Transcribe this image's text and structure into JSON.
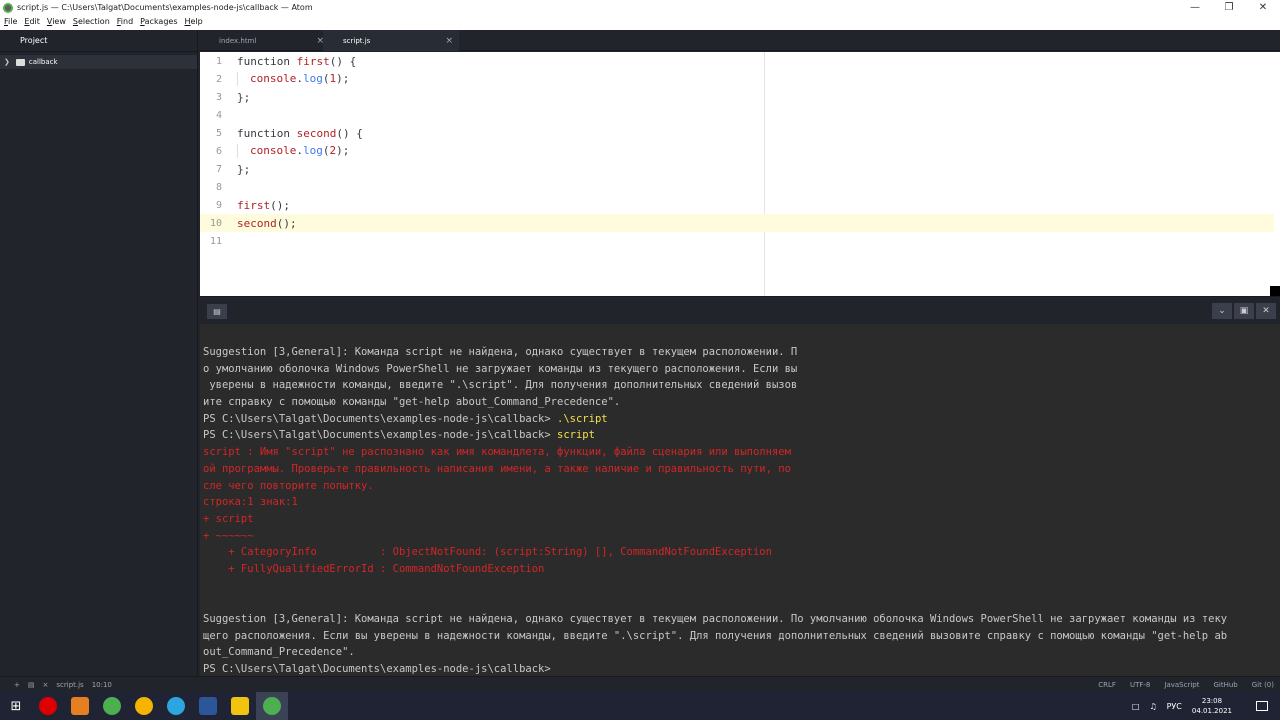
{
  "window": {
    "title": "script.js — C:\\Users\\Talgat\\Documents\\examples-node-js\\callback — Atom"
  },
  "menu": [
    "File",
    "Edit",
    "View",
    "Selection",
    "Find",
    "Packages",
    "Help"
  ],
  "sidebar": {
    "header": "Project",
    "items": [
      {
        "label": "callback"
      }
    ]
  },
  "tabs": [
    {
      "label": "index.html"
    },
    {
      "label": "script.js"
    }
  ],
  "editor": {
    "lines": [
      "1",
      "2",
      "3",
      "4",
      "5",
      "6",
      "7",
      "8",
      "9",
      "10",
      "11"
    ],
    "code": {
      "l1_kw": "function ",
      "l1_fn": "first",
      "l1_rest": "() {",
      "l2_obj": "console",
      "l2_dot": ".",
      "l2_m": "log",
      "l2_p1": "(",
      "l2_n": "1",
      "l2_p2": ");",
      "l3": "};",
      "l5_kw": "function ",
      "l5_fn": "second",
      "l5_rest": "() {",
      "l6_obj": "console",
      "l6_dot": ".",
      "l6_m": "log",
      "l6_p1": "(",
      "l6_n": "2",
      "l6_p2": ");",
      "l7": "};",
      "l9_fn": "first",
      "l9_rest": "();",
      "l10_fn": "second",
      "l10_rest": "();"
    }
  },
  "terminal": {
    "t1": "Suggestion [3,General]: Команда script не найдена, однако существует в текущем расположении. П",
    "t2": "о умолчанию оболочка Windows PowerShell не загружает команды из текущего расположения. Если вы",
    "t3": " уверены в надежности команды, введите \".\\script\". Для получения дополнительных сведений вызов",
    "t4": "ите справку с помощью команды \"get-help about_Command_Precedence\".",
    "t5_prompt": "PS C:\\Users\\Talgat\\Documents\\examples-node-js\\callback> ",
    "t5_cmd": ".\\script",
    "t6_prompt": "PS C:\\Users\\Talgat\\Documents\\examples-node-js\\callback> ",
    "t6_cmd": "script",
    "e1": "script : Имя \"script\" не распознано как имя командлета, функции, файла сценария или выполняем",
    "e2": "ой программы. Проверьте правильность написания имени, а также наличие и правильность пути, по",
    "e3": "сле чего повторите попытку.",
    "e4": "строка:1 знак:1",
    "e5": "+ script",
    "e6": "+ ~~~~~~",
    "e7": "    + CategoryInfo          : ObjectNotFound: (script:String) [], CommandNotFoundException",
    "e8": "    + FullyQualifiedErrorId : CommandNotFoundException",
    "s1": "Suggestion [3,General]: Команда script не найдена, однако существует в текущем расположении. По умолчанию оболочка Windows PowerShell не загружает команды из теку",
    "s2": "щего расположения. Если вы уверены в надежности команды, введите \".\\script\". Для получения дополнительных сведений вызовите справку с помощью команды \"get-help ab",
    "s3": "out_Command_Precedence\".",
    "p": "PS C:\\Users\\Talgat\\Documents\\examples-node-js\\callback>"
  },
  "status": {
    "file": "script.js",
    "pos": "10:10",
    "crlf": "CRLF",
    "enc": "UTF-8",
    "lang": "JavaScript",
    "github": "GitHub",
    "git": "Git (0)"
  },
  "taskbar": {
    "lang": "РУС",
    "time": "23:08",
    "date": "04.01.2021"
  }
}
